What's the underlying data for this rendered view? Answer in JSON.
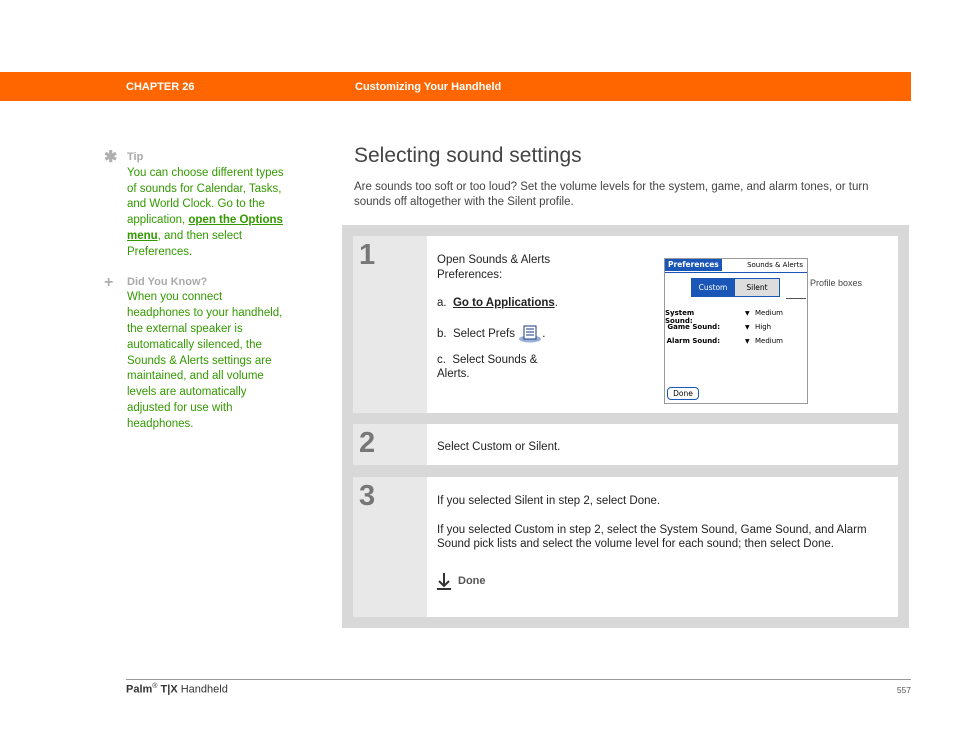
{
  "header": {
    "chapter": "CHAPTER 26",
    "section": "Customizing Your Handheld",
    "color": "#ff6600"
  },
  "sidebar": {
    "tip": {
      "icon": "asterisk-icon",
      "title": "Tip",
      "text_before": "You can choose different types of sounds for Calendar, Tasks, and World Clock. Go to the application, ",
      "link": "open the Options menu",
      "text_after": ", and then select Preferences."
    },
    "did_you_know": {
      "icon": "plus-icon",
      "title": "Did You Know?",
      "text": "When you connect headphones to your handheld, the external speaker is automatically silenced, the Sounds & Alerts settings are maintained, and all volume levels are automatically adjusted for use with headphones."
    },
    "color": "#339900"
  },
  "main": {
    "title": "Selecting sound settings",
    "intro": "Are sounds too soft or too loud? Set the volume levels for the system, game, and alarm tones, or turn sounds off altogether with the Silent profile."
  },
  "steps": [
    {
      "number": "1",
      "lines": {
        "open": "Open Sounds & Alerts Preferences:",
        "a_prefix": "a.",
        "a_link": "Go to Applications",
        "a_suffix": ".",
        "b_prefix": "b.",
        "b_text": "Select Prefs",
        "b_suffix": ".",
        "c_prefix": "c.",
        "c_text": "Select Sounds & Alerts."
      },
      "screen": {
        "title": "Preferences",
        "menu": "Sounds & Alerts",
        "seg_custom": "Custom",
        "seg_silent": "Silent",
        "rows": [
          {
            "label": "System Sound:",
            "value": "Medium"
          },
          {
            "label": "Game Sound:",
            "value": "High"
          },
          {
            "label": "Alarm Sound:",
            "value": "Medium"
          }
        ],
        "done": "Done"
      },
      "callout": "Profile boxes"
    },
    {
      "number": "2",
      "text": "Select Custom or Silent."
    },
    {
      "number": "3",
      "para1": "If you selected Silent in step 2, select Done.",
      "para2": "If you selected Custom in step 2, select the System Sound, Game Sound, and Alarm Sound pick lists and select the volume level for each sound; then select Done.",
      "done_label": "Done"
    }
  ],
  "footer": {
    "brand": "Palm",
    "reg": "®",
    "model": "T|X",
    "product": "Handheld",
    "page": "557"
  }
}
